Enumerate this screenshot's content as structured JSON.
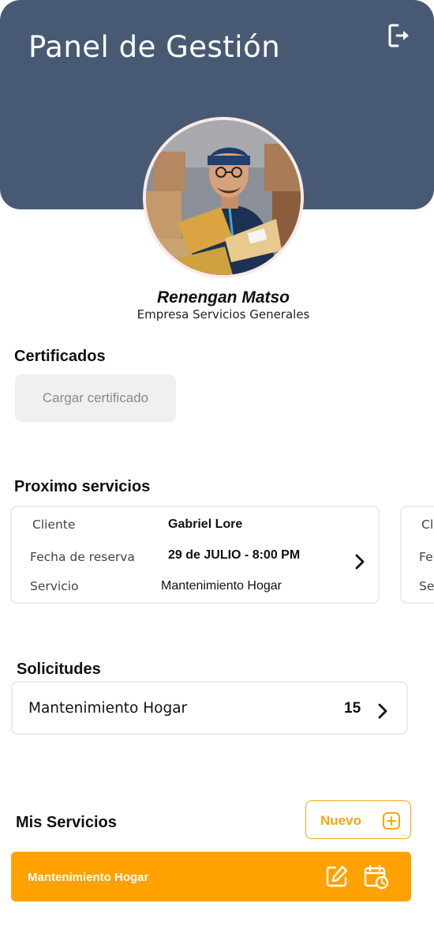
{
  "header": {
    "title": "Panel de Gestión",
    "logout_icon": "logout-icon",
    "background_color": "#485a73"
  },
  "profile": {
    "name": "Renengan Matso",
    "company": "Empresa Servicios Generales"
  },
  "certificates": {
    "title": "Certificados",
    "upload_label": "Cargar certificado"
  },
  "upcoming": {
    "title": "Proximo servicios",
    "cards": [
      {
        "client_label": "Cliente",
        "client_value": "Gabriel Lore",
        "date_label": "Fecha de reserva",
        "date_value": "29 de JULIO - 8:00 PM",
        "service_label": "Servicio",
        "service_value": "Mantenimiento Hogar"
      },
      {
        "client_label": "Cl",
        "date_label": "Fe",
        "service_label": "Se"
      }
    ]
  },
  "requests": {
    "title": "Solicitudes",
    "items": [
      {
        "label": "Mantenimiento Hogar",
        "count": "15"
      }
    ]
  },
  "my_services": {
    "title": "Mis Servicios",
    "new_label": "Nuevo",
    "items": [
      {
        "label": "Mantenimiento Hogar"
      }
    ],
    "accent_color": "#ffa200"
  }
}
